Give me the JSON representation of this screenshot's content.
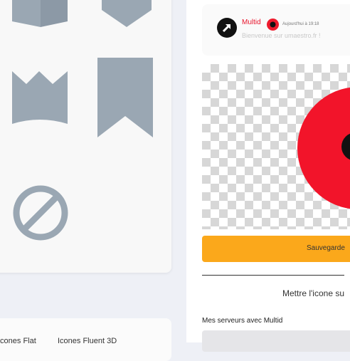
{
  "icon_gallery": {
    "shapes": [
      "cube-shape",
      "shield-shape",
      "crown-shape",
      "bookmark-shape",
      "forbidden-shape"
    ],
    "shape_color": "#9aa7b3"
  },
  "bottom_tabs": {
    "tabs": [
      "Icones Flat",
      "Icones Fluent 3D"
    ]
  },
  "message_preview": {
    "bot_name": "Multid",
    "time": "Aujourd'hui à 19:18",
    "message": "Bienvenue sur umaestro.fr !"
  },
  "icon_preview": {
    "background_color": "#f2142a"
  },
  "actions": {
    "save_label": "Sauvegarde",
    "set_icon_label": "Mettre l'icone su",
    "accent_color": "#fba81b"
  },
  "servers": {
    "heading": "Mes serveurs avec Multid"
  }
}
